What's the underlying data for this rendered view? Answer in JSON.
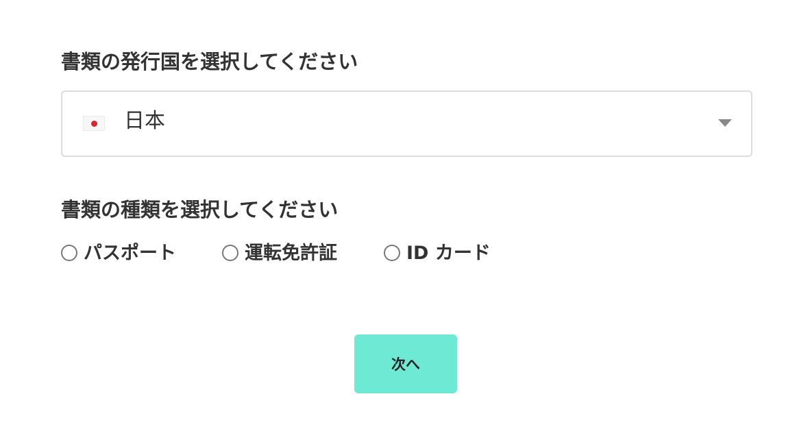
{
  "country_section": {
    "title": "書類の発行国を選択してください",
    "selected_country": "日本",
    "flag_icon": "japan-flag-icon",
    "dropdown_icon": "chevron-down-icon"
  },
  "document_section": {
    "title": "書類の種類を選択してください",
    "options": [
      {
        "label": "パスポート",
        "selected": false
      },
      {
        "label": "運転免許証",
        "selected": false
      },
      {
        "label": "ID カード",
        "selected": false
      }
    ]
  },
  "actions": {
    "next_label": "次へ",
    "next_color": "#6eead4"
  },
  "colors": {
    "text": "#333333",
    "border": "#dcdcdc",
    "flag_red": "#d8282f"
  }
}
